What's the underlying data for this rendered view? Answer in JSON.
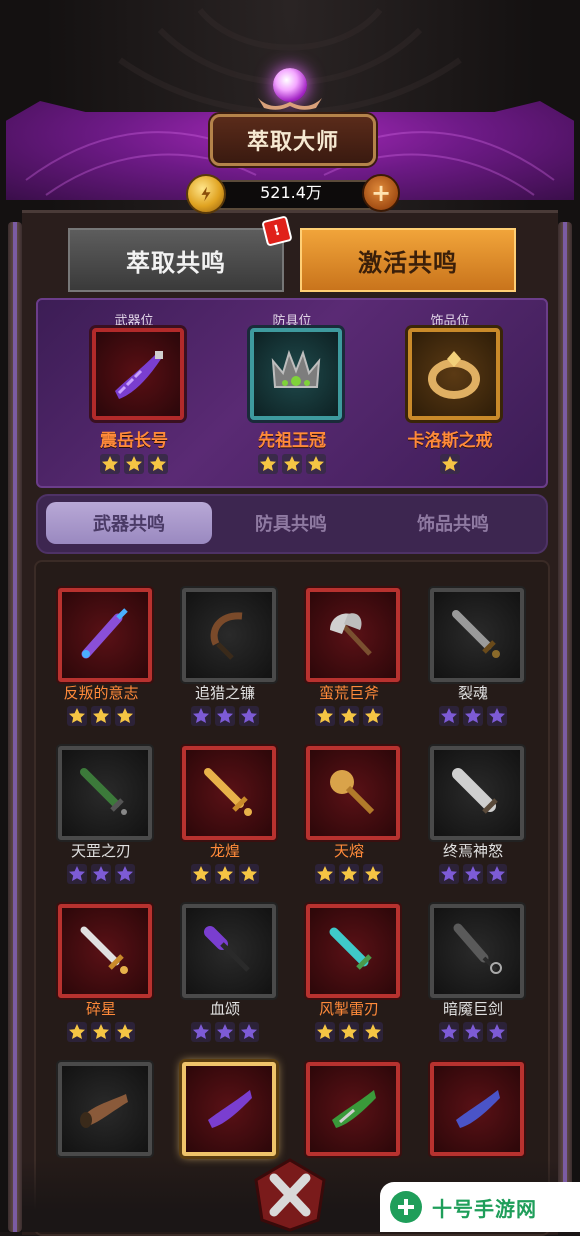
{
  "header": {
    "title": "萃取大师"
  },
  "currency": {
    "amount": "521.4万",
    "icon": "gold-coin-icon",
    "add_icon": "plus-icon"
  },
  "main_tabs": [
    {
      "label": "萃取共鸣",
      "active": false,
      "alert": "!"
    },
    {
      "label": "激活共鸣",
      "active": true
    }
  ],
  "equipped": [
    {
      "slot": "武器位",
      "name": "震岳长号",
      "stars": 3,
      "frame": "weapon",
      "icon": "horn-icon"
    },
    {
      "slot": "防具位",
      "name": "先祖王冠",
      "stars": 3,
      "frame": "armor",
      "icon": "crown-icon"
    },
    {
      "slot": "饰品位",
      "name": "卡洛斯之戒",
      "stars": 1,
      "frame": "acc",
      "icon": "ring-icon"
    }
  ],
  "sub_tabs": [
    {
      "label": "武器共鸣",
      "active": true
    },
    {
      "label": "防具共鸣",
      "active": false
    },
    {
      "label": "饰品共鸣",
      "active": false
    }
  ],
  "items": [
    {
      "name": "反叛的意志",
      "rarity": "red",
      "star_color": "gold",
      "icon": "spiked-mace-icon"
    },
    {
      "name": "追猎之镰",
      "rarity": "grey",
      "star_color": "purple",
      "icon": "sickle-icon"
    },
    {
      "name": "蛮荒巨斧",
      "rarity": "red",
      "star_color": "gold",
      "icon": "axe-icon"
    },
    {
      "name": "裂魂",
      "rarity": "grey",
      "star_color": "purple",
      "icon": "dagger-icon"
    },
    {
      "name": "天罡之刃",
      "rarity": "grey",
      "star_color": "purple",
      "icon": "green-sword-icon"
    },
    {
      "name": "龙煌",
      "rarity": "red",
      "star_color": "gold",
      "icon": "gold-sword-icon"
    },
    {
      "name": "天熔",
      "rarity": "red",
      "star_color": "gold",
      "icon": "gold-mace-icon"
    },
    {
      "name": "终焉神怒",
      "rarity": "grey",
      "star_color": "purple",
      "icon": "great-sword-icon"
    },
    {
      "name": "碎星",
      "rarity": "red",
      "star_color": "gold",
      "icon": "silver-sword-icon"
    },
    {
      "name": "血颂",
      "rarity": "grey",
      "star_color": "purple",
      "icon": "purple-mace-icon"
    },
    {
      "name": "风掣雷刃",
      "rarity": "red",
      "star_color": "gold",
      "icon": "cyan-sword-icon"
    },
    {
      "name": "暗魇巨剑",
      "rarity": "grey",
      "star_color": "purple",
      "icon": "dark-blade-icon"
    },
    {
      "name": "",
      "rarity": "grey",
      "star_color": "purple",
      "icon": "brown-horn-icon"
    },
    {
      "name": "",
      "rarity": "red",
      "star_color": "gold",
      "icon": "purple-horn-icon",
      "selected": true
    },
    {
      "name": "",
      "rarity": "red",
      "star_color": "gold",
      "icon": "green-horn-icon"
    },
    {
      "name": "",
      "rarity": "red",
      "star_color": "gold",
      "icon": "blue-horn-icon"
    }
  ],
  "close": {
    "icon": "close-x-icon"
  },
  "watermark": {
    "text": "十号手游网",
    "icon": "watermark-logo-icon"
  }
}
